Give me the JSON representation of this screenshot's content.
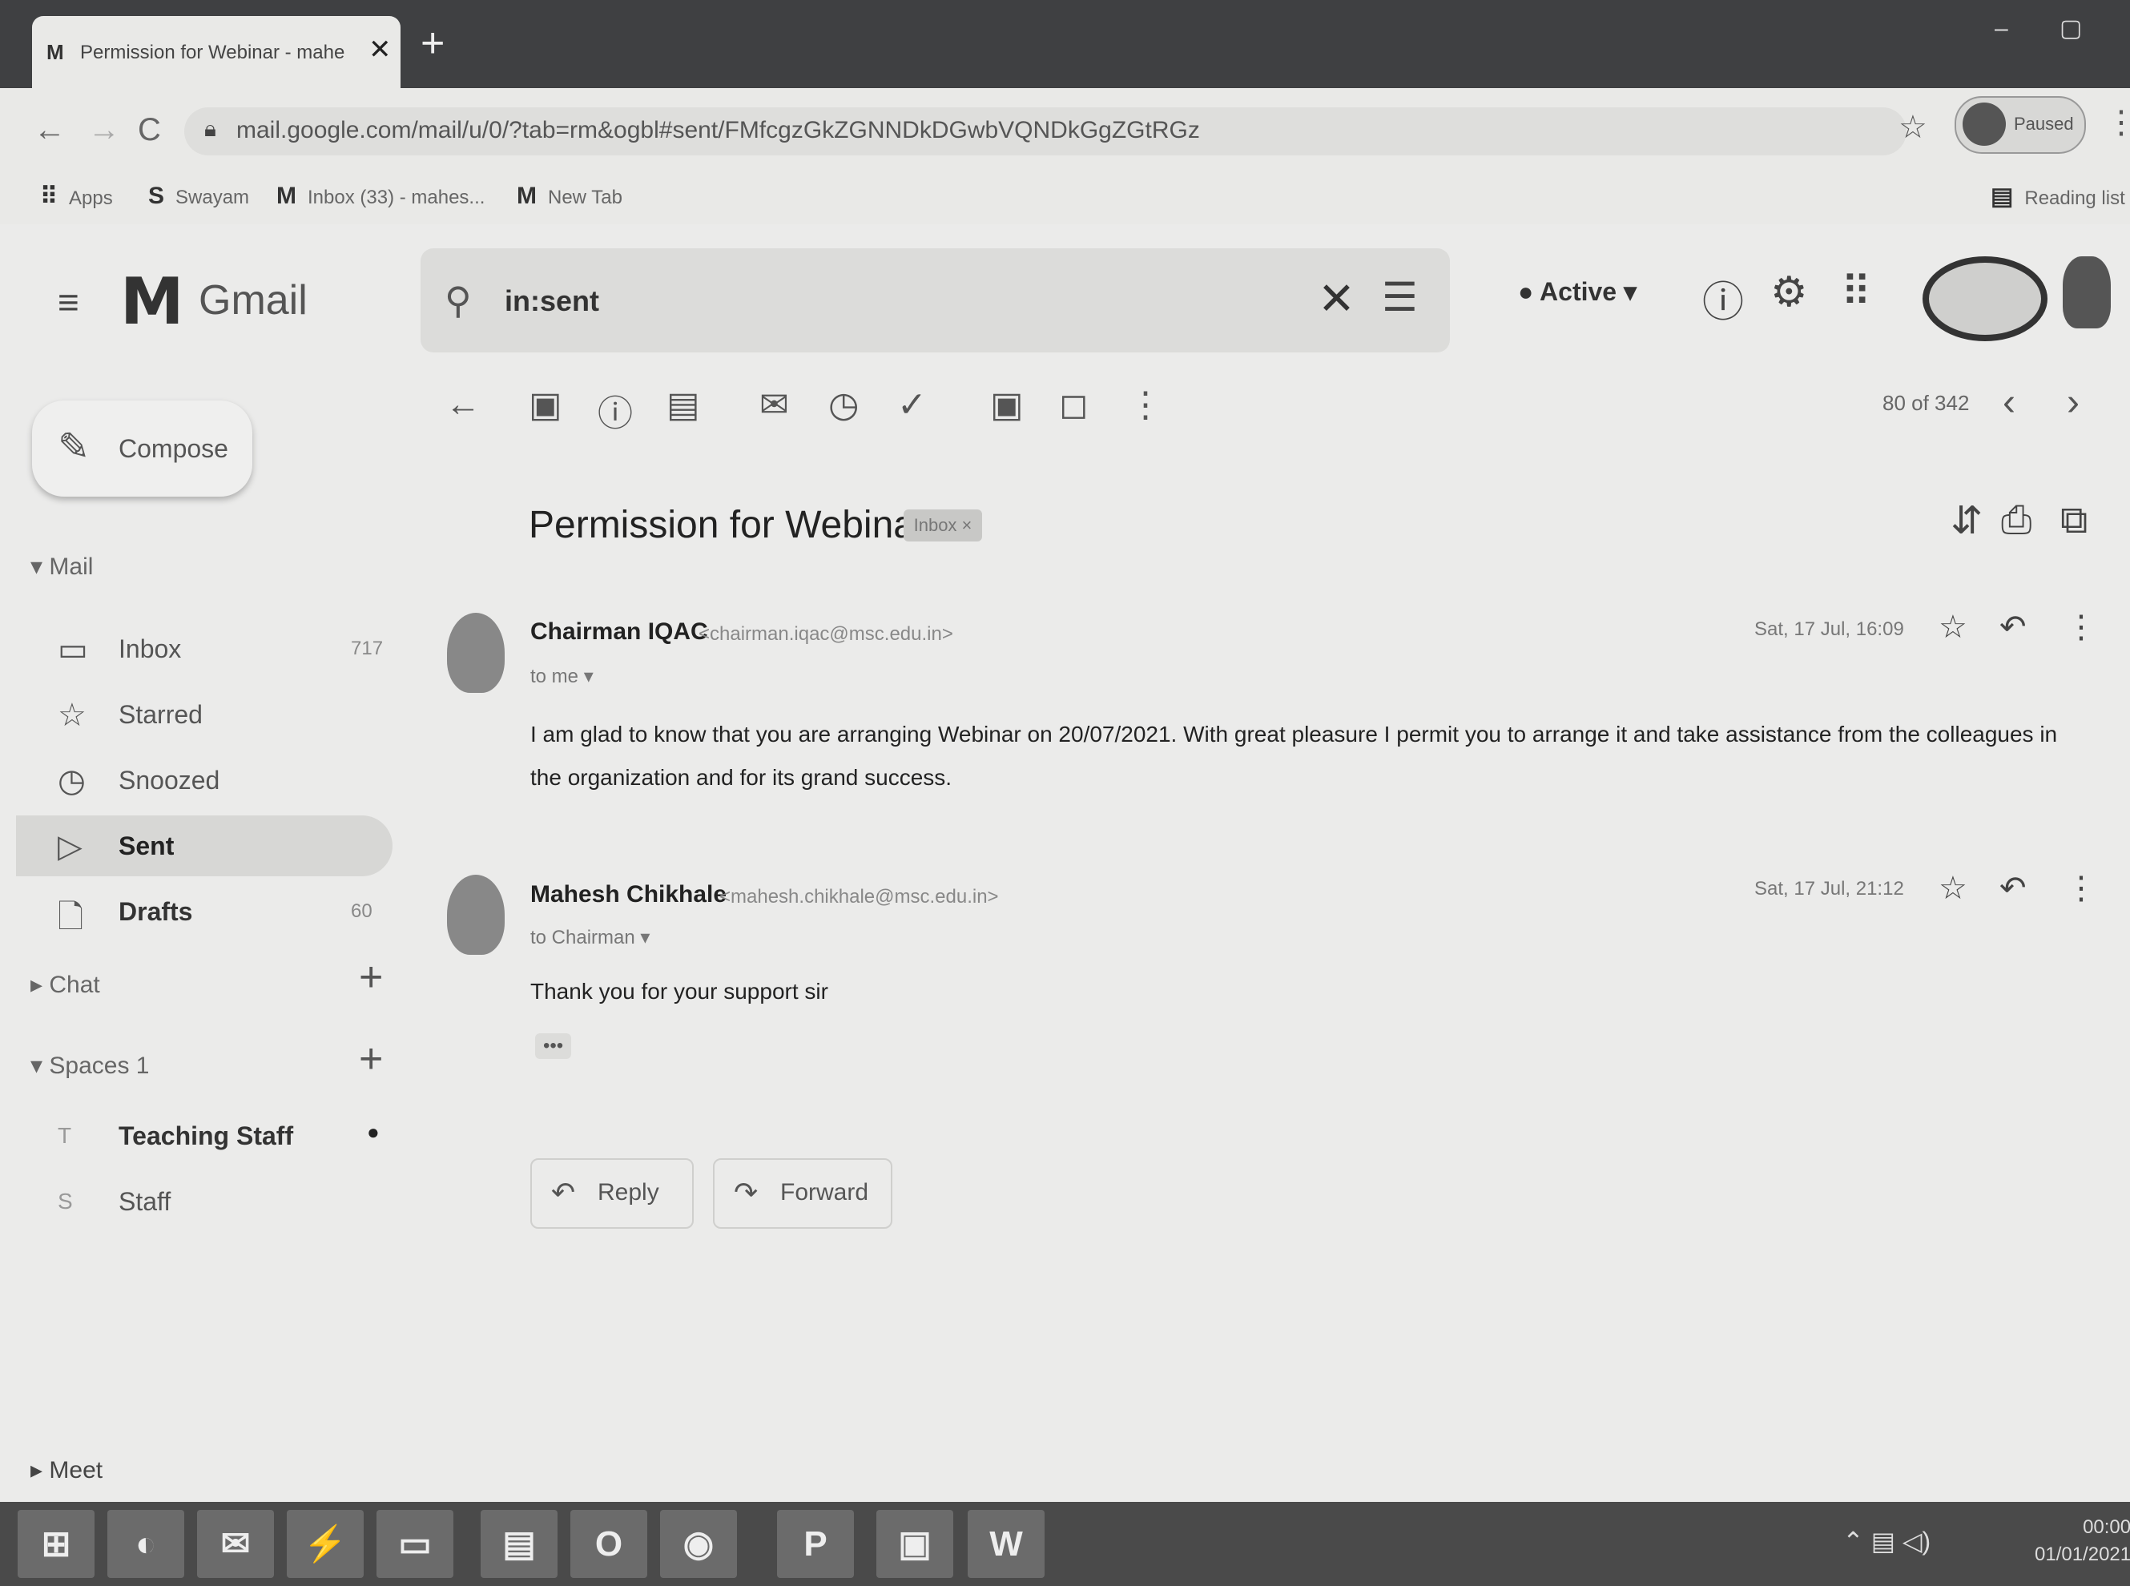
{
  "browser": {
    "tab_title": "Permission for Webinar - mahe",
    "tab_favicon": "M",
    "tab_close": "✕",
    "new_tab": "+",
    "window_controls": "– ▢ ✕",
    "back": "←",
    "forward": "→",
    "reload": "C",
    "url": "mail.google.com/mail/u/0/?tab=rm&ogbl#sent/FMfcgzGkZGNNDkDGwbVQNDkGgZGtRGz",
    "bookmarks": [
      {
        "icon": "⠿",
        "label": "Apps"
      },
      {
        "icon": "S",
        "label": "Swayam"
      },
      {
        "icon": "M",
        "label": "Inbox (33) - mahes..."
      },
      {
        "icon": "M",
        "label": "New Tab"
      }
    ],
    "reading_list": "Reading list",
    "profile_label": "Paused"
  },
  "gmail": {
    "product_name": "Gmail",
    "search_query": "in:sent",
    "status": "Active ▾",
    "compose_label": "Compose",
    "mail_section": "▾ Mail",
    "nav": [
      {
        "label": "Inbox",
        "count": "717"
      },
      {
        "label": "Starred",
        "count": ""
      },
      {
        "label": "Snoozed",
        "count": ""
      },
      {
        "label": "Sent",
        "count": ""
      },
      {
        "label": "Drafts",
        "count": "60"
      }
    ],
    "chat_section": "▸ Chat",
    "spaces_section": "▾ Spaces  1",
    "spaces": [
      {
        "label": "Teaching Staff",
        "badge": "●"
      },
      {
        "label": "Staff",
        "badge": ""
      }
    ],
    "meet_section": "▸ Meet",
    "page_count": "80 of 342"
  },
  "thread": {
    "subject": "Permission for Webinar",
    "label": "Inbox ×",
    "messages": [
      {
        "sender": "Chairman IQAC",
        "email": "<chairman.iqac@msc.edu.in>",
        "to": "to me ▾",
        "date": "Sat, 17 Jul, 16:09",
        "body": "I am glad to know that you are arranging Webinar on 20/07/2021. With great pleasure I permit you to arrange it and take assistance from the colleagues in the organization and for its grand success."
      },
      {
        "sender": "Mahesh Chikhale",
        "email": "<mahesh.chikhale@msc.edu.in>",
        "to": "to Chairman ▾",
        "date": "Sat, 17 Jul, 21:12",
        "body": "Thank you for your support sir",
        "ellipsis": "•••"
      }
    ],
    "reply_label": "Reply",
    "forward_label": "Forward"
  },
  "taskbar": {
    "apps": [
      "⊞",
      "◐",
      "✉",
      "⚡",
      "▭",
      "▤",
      "O",
      "◉",
      "P",
      "▣",
      "W"
    ],
    "systray": "⌃ ▤ ◁)",
    "time": "00:00",
    "date": "01/01/2021"
  },
  "colors": {
    "chrome_dark": "#3f4042",
    "page_bg": "#ebebea",
    "selected": "#d7d7d5",
    "taskbar": "#4a4a4a"
  }
}
